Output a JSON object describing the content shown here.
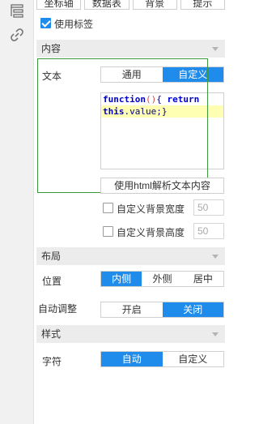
{
  "top_tabs": [
    "坐标轴",
    "数据表",
    "背景",
    "提示"
  ],
  "use_label": {
    "label": "使用标签",
    "checked": true
  },
  "content_section": {
    "title": "内容",
    "text_label": "文本",
    "text_mode": {
      "options": [
        "通用",
        "自定义"
      ],
      "selected": "自定义"
    },
    "code_lines": [
      "function(){ return",
      "this.value;}"
    ],
    "html_parse_button": "使用html解析文本内容",
    "custom_bg_width": {
      "label": "自定义背景宽度",
      "value": "50",
      "checked": false
    },
    "custom_bg_height": {
      "label": "自定义背景高度",
      "value": "50",
      "checked": false
    }
  },
  "layout_section": {
    "title": "布局",
    "position_label": "位置",
    "position": {
      "options": [
        "内侧",
        "外侧",
        "居中"
      ],
      "selected": "内侧"
    },
    "auto_adjust_label": "自动调整",
    "auto_adjust": {
      "options": [
        "开启",
        "关闭"
      ],
      "selected": "关闭"
    }
  },
  "style_section": {
    "title": "样式",
    "char_label": "字符",
    "char": {
      "options": [
        "自动",
        "自定义"
      ],
      "selected": "自动"
    }
  },
  "icons": {
    "strip_top": "list-icon",
    "strip_second": "link-icon"
  },
  "colors": {
    "accent": "#1f8ceb",
    "section_bg": "#ececec",
    "selection_box": "#3c9a3c"
  }
}
